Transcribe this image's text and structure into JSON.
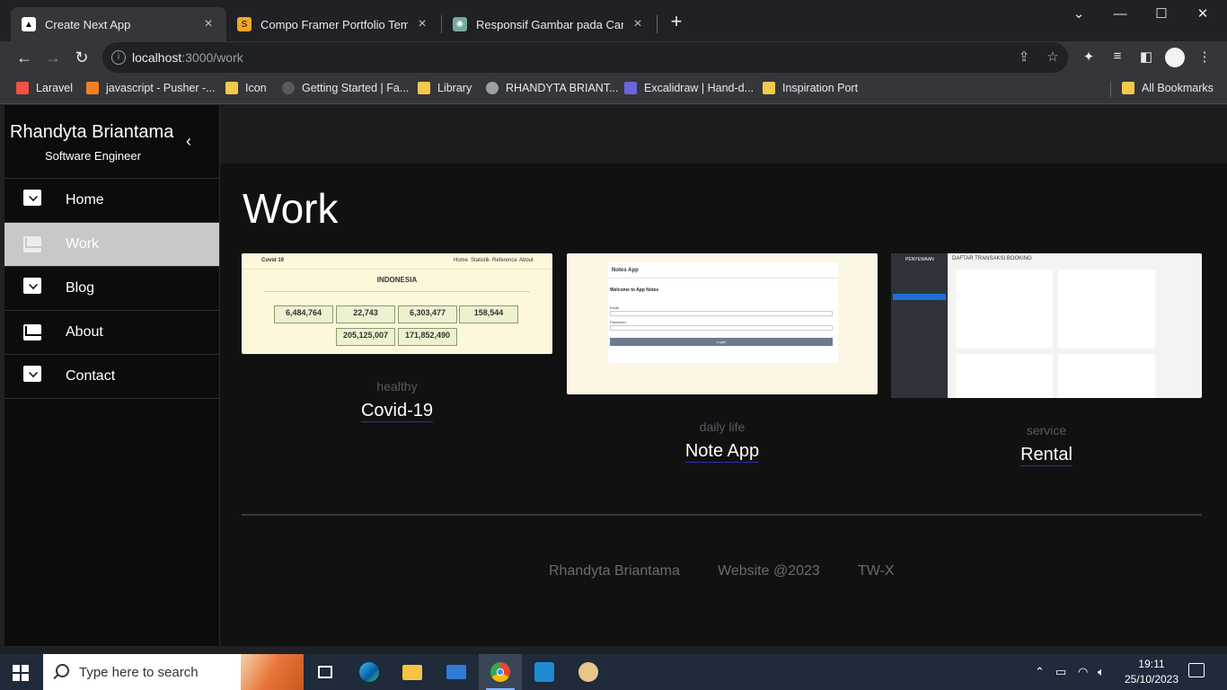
{
  "browser": {
    "tabs": [
      {
        "title": "Create Next App",
        "active": true
      },
      {
        "title": "Compo Framer Portfolio Templat",
        "active": false
      },
      {
        "title": "Responsif Gambar pada Card",
        "active": false
      }
    ],
    "url_host": "localhost",
    "url_path": ":3000/work",
    "bookmarks": [
      "Laravel",
      "javascript - Pusher -...",
      "Icon",
      "Getting Started | Fa...",
      "Library",
      "RHANDYTA BRIANT...",
      "Excalidraw | Hand-d...",
      "Inspiration Port"
    ],
    "all_bookmarks": "All Bookmarks"
  },
  "sidebar": {
    "name": "Rhandyta Briantama",
    "role": "Software Engineer",
    "items": [
      {
        "label": "Home",
        "icon": "inbox-icon"
      },
      {
        "label": "Work",
        "icon": "mail-icon",
        "active": true
      },
      {
        "label": "Blog",
        "icon": "inbox-icon"
      },
      {
        "label": "About",
        "icon": "mail-icon"
      },
      {
        "label": "Contact",
        "icon": "inbox-icon"
      }
    ]
  },
  "main": {
    "title": "Work",
    "cards": [
      {
        "category": "healthy",
        "title": "Covid-19",
        "thumb": {
          "brand": "Covid 19",
          "nav": [
            "Home",
            "Statistik",
            "Reference",
            "About"
          ],
          "heading": "INDONESIA",
          "stats": [
            "6,484,764",
            "22,743",
            "6,303,477",
            "158,544",
            "205,125,007",
            "171,852,490"
          ]
        }
      },
      {
        "category": "daily life",
        "title": "Note App",
        "thumb": {
          "brand": "Notes App",
          "welcome": "Welcome to App Notes",
          "email_label": "Email",
          "password_label": "Password",
          "button": "Login"
        }
      },
      {
        "category": "service",
        "title": "Rental",
        "thumb": {
          "brand": "PENYEWAAN",
          "heading": "DAFTAR TRANSAKSI BOOKING"
        }
      }
    ],
    "footer": [
      "Rhandyta Briantama",
      "Website @2023",
      "TW-X"
    ]
  },
  "taskbar": {
    "search_placeholder": "Type here to search",
    "time": "19:11",
    "date": "25/10/2023"
  },
  "colors": {
    "page_bg": "#111111",
    "sidebar_active": "#c8c8c8",
    "link_underline": "#2f2fb0"
  }
}
